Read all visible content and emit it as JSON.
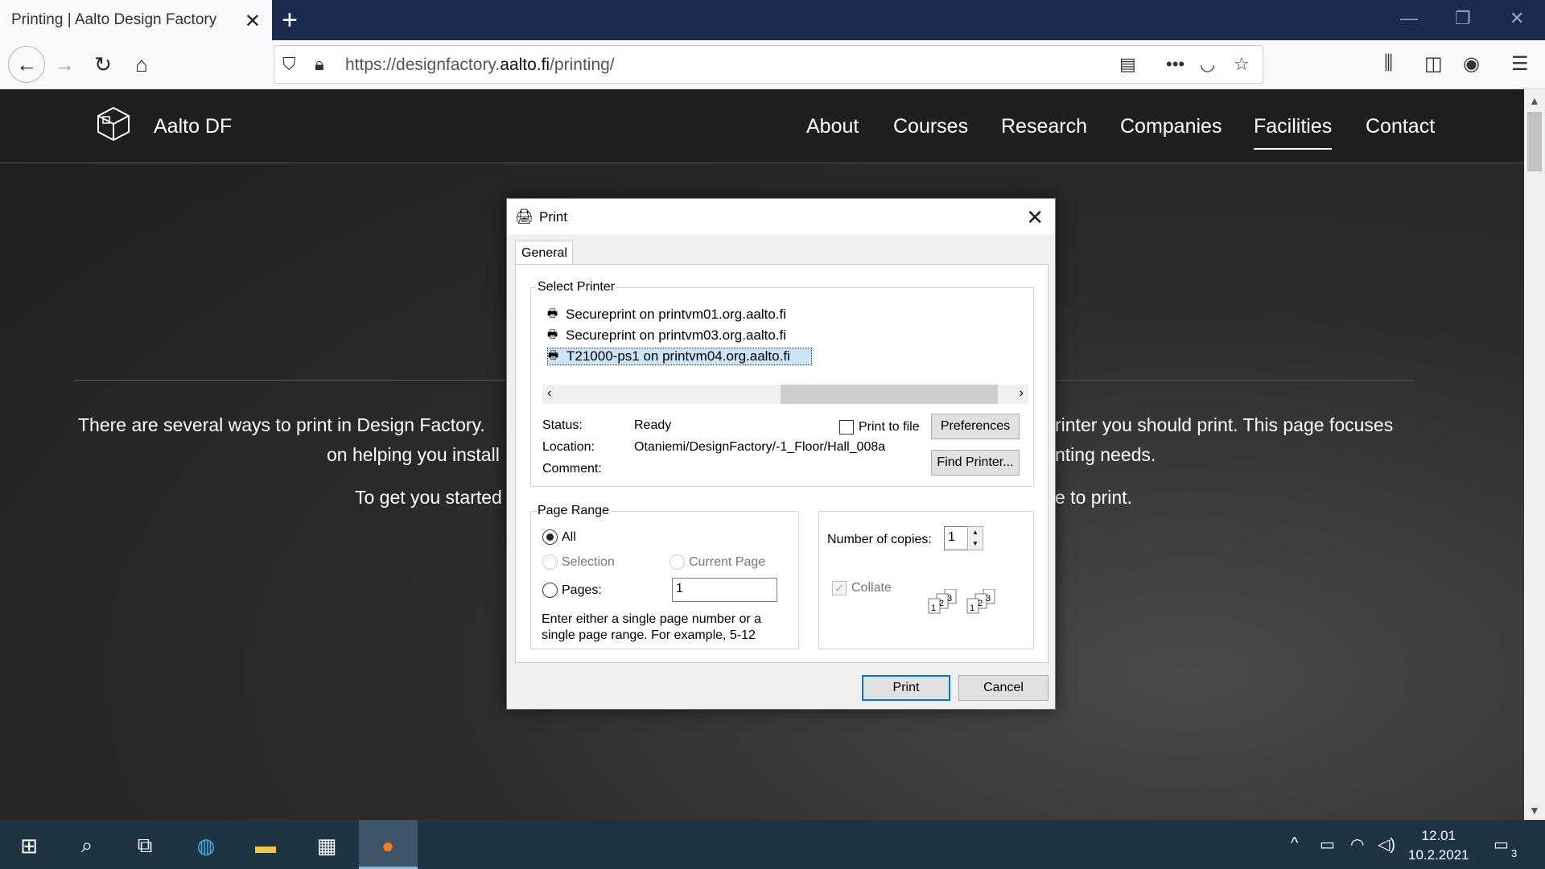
{
  "browser": {
    "tab_title": "Printing | Aalto Design Factory",
    "url_prefix": "https://designfactory.",
    "url_domain": "aalto.fi",
    "url_path": "/printing/",
    "icons": [
      "back-icon",
      "forward-icon",
      "reload-icon",
      "home-icon",
      "shield-icon",
      "lock-icon",
      "reader-view-icon",
      "more-icon",
      "pocket-icon",
      "bookmark-star-icon",
      "library-icon",
      "sidebar-icon",
      "account-icon",
      "menu-icon"
    ]
  },
  "site": {
    "name": "Aalto DF",
    "nav": [
      {
        "label": "About"
      },
      {
        "label": "Courses"
      },
      {
        "label": "Research"
      },
      {
        "label": "Companies"
      },
      {
        "label": "Facilities",
        "active": true
      },
      {
        "label": "Contact"
      }
    ],
    "para1_left": "There are several ways to print in Design Factory.",
    "para1_right": "rinter you should print. This page focuses",
    "para2_left": "on helping you install",
    "para2_right": "nting needs.",
    "para3_left": "To get you started",
    "para3_right": "e to print."
  },
  "dialog": {
    "title": "Print",
    "tab": "General",
    "select_printer_label": "Select Printer",
    "printers": [
      {
        "name": "Secureprint on printvm01.org.aalto.fi"
      },
      {
        "name": "Secureprint on printvm03.org.aalto.fi"
      },
      {
        "name": "T21000-ps1 on printvm04.org.aalto.fi",
        "selected": true
      }
    ],
    "status_label": "Status:",
    "status_value": "Ready",
    "location_label": "Location:",
    "location_value": "Otaniemi/DesignFactory/-1_Floor/Hall_008a",
    "comment_label": "Comment:",
    "print_to_file": "Print to file",
    "preferences_btn": "Preferences",
    "find_printer_btn": "Find Printer...",
    "page_range_label": "Page Range",
    "range_all": "All",
    "range_selection": "Selection",
    "range_current": "Current Page",
    "range_pages": "Pages:",
    "pages_value": "1",
    "range_hint_1": "Enter either a single page number or a",
    "range_hint_2": "single page range.  For example, 5-12",
    "copies_label": "Number of copies:",
    "copies_value": "1",
    "collate_label": "Collate",
    "print_btn": "Print",
    "cancel_btn": "Cancel"
  },
  "taskbar": {
    "icons": [
      "windows-start-icon",
      "search-icon",
      "task-view-icon",
      "edge-icon",
      "file-explorer-icon",
      "store-icon",
      "firefox-icon"
    ],
    "time": "12.01",
    "date": "10.2.2021",
    "notification_count": "3"
  }
}
